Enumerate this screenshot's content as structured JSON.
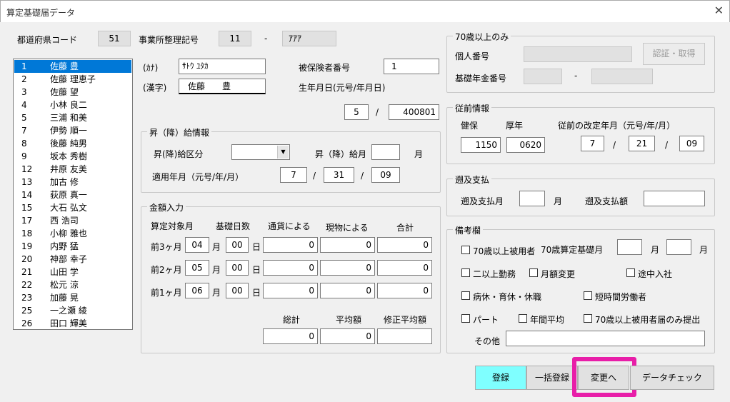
{
  "window": {
    "title": "算定基礎届データ",
    "close_glyph": "✕"
  },
  "header": {
    "pref_code_label": "都道府県コード",
    "pref_code_value": "51",
    "office_label": "事業所整理記号",
    "office_code1": "11",
    "office_sep": "-",
    "office_code2": "ｱｱｱ"
  },
  "employees": [
    {
      "no": "1",
      "name": "佐藤 豊"
    },
    {
      "no": "2",
      "name": "佐藤 理恵子"
    },
    {
      "no": "3",
      "name": "佐藤 望"
    },
    {
      "no": "4",
      "name": "小林 良二"
    },
    {
      "no": "5",
      "name": "三浦 和美"
    },
    {
      "no": "7",
      "name": "伊勢 順一"
    },
    {
      "no": "8",
      "name": "後藤 純男"
    },
    {
      "no": "9",
      "name": "坂本 秀樹"
    },
    {
      "no": "12",
      "name": "井原 友美"
    },
    {
      "no": "13",
      "name": "加古 修"
    },
    {
      "no": "14",
      "name": "荻原 真一"
    },
    {
      "no": "15",
      "name": "大石 弘文"
    },
    {
      "no": "17",
      "name": "西 浩司"
    },
    {
      "no": "18",
      "name": "小柳 雅也"
    },
    {
      "no": "19",
      "name": "内野 猛"
    },
    {
      "no": "20",
      "name": "神部 幸子"
    },
    {
      "no": "21",
      "name": "山田 学"
    },
    {
      "no": "22",
      "name": "松元 涼"
    },
    {
      "no": "23",
      "name": "加藤 晃"
    },
    {
      "no": "25",
      "name": "一之瀬 綾"
    },
    {
      "no": "26",
      "name": "田口 輝美"
    }
  ],
  "person": {
    "kana_label": "(ｶﾅ)",
    "kana_value": "ｻﾄｳ ﾕﾀｶ",
    "kanji_label": "(漢字)",
    "kanji_value": "佐藤　　豊",
    "insured_no_label": "被保険者番号",
    "insured_no_value": "1",
    "birth_label": "生年月日(元号/年月日)",
    "birth_era": "5",
    "birth_sep": "/",
    "birth_date": "400801"
  },
  "raise": {
    "legend": "昇（降）給情報",
    "type_label": "昇(降)給区分",
    "type_value": "",
    "month_label": "昇（降）給月",
    "month_value": "",
    "month_unit": "月",
    "apply_label": "適用年月（元号/年/月）",
    "apply_era": "7",
    "apply_year": "31",
    "apply_month": "09",
    "sep": "/"
  },
  "amount": {
    "legend": "金額入力",
    "col_month": "算定対象月",
    "col_days": "基礎日数",
    "col_currency": "通貨による",
    "col_goods": "現物による",
    "col_total": "合計",
    "month_unit": "月",
    "day_unit": "日",
    "rows": [
      {
        "label": "前3ヶ月",
        "month": "04",
        "days": "00",
        "currency": "0",
        "goods": "0",
        "total": "0"
      },
      {
        "label": "前2ヶ月",
        "month": "05",
        "days": "00",
        "currency": "0",
        "goods": "0",
        "total": "0"
      },
      {
        "label": "前1ヶ月",
        "month": "06",
        "days": "00",
        "currency": "0",
        "goods": "0",
        "total": "0"
      }
    ],
    "sum_label": "総計",
    "sum_value": "0",
    "avg_label": "平均額",
    "avg_value": "0",
    "adj_label": "修正平均額",
    "adj_value": ""
  },
  "over70": {
    "legend": "70歳以上のみ",
    "personal_no_label": "個人番号",
    "auth_button": "認証・取得",
    "pension_no_label": "基礎年金番号",
    "sep": "-"
  },
  "previous": {
    "legend": "従前情報",
    "health_label": "健保",
    "health_value": "1150",
    "pension_label": "厚年",
    "pension_value": "0620",
    "revised_label": "従前の改定年月（元号/年/月）",
    "era": "7",
    "year": "21",
    "month": "09",
    "sep": "/"
  },
  "retro": {
    "legend": "遡及支払",
    "month_label": "遡及支払月",
    "month_value": "",
    "month_unit": "月",
    "amount_label": "遡及支払額",
    "amount_value": ""
  },
  "notes": {
    "legend": "備考欄",
    "over70_employee": "70歳以上被用者",
    "calc_month_label": "70歳算定基礎月",
    "month_unit": "月",
    "multi_work": "二以上勤務",
    "monthly_change": "月額変更",
    "mid_join": "途中入社",
    "leave": "病休・育休・休職",
    "short_time": "短時間労働者",
    "part": "パート",
    "annual_avg": "年間平均",
    "over70_only": "70歳以上被用者届のみ提出",
    "other_label": "その他",
    "other_value": ""
  },
  "buttons": {
    "register": "登録",
    "bulk_register": "一括登録",
    "change": "変更へ",
    "data_check": "データチェック"
  },
  "colors": {
    "selection": "#0078d7",
    "highlight": "#e81ea8",
    "register_bg": "#7fffff"
  }
}
